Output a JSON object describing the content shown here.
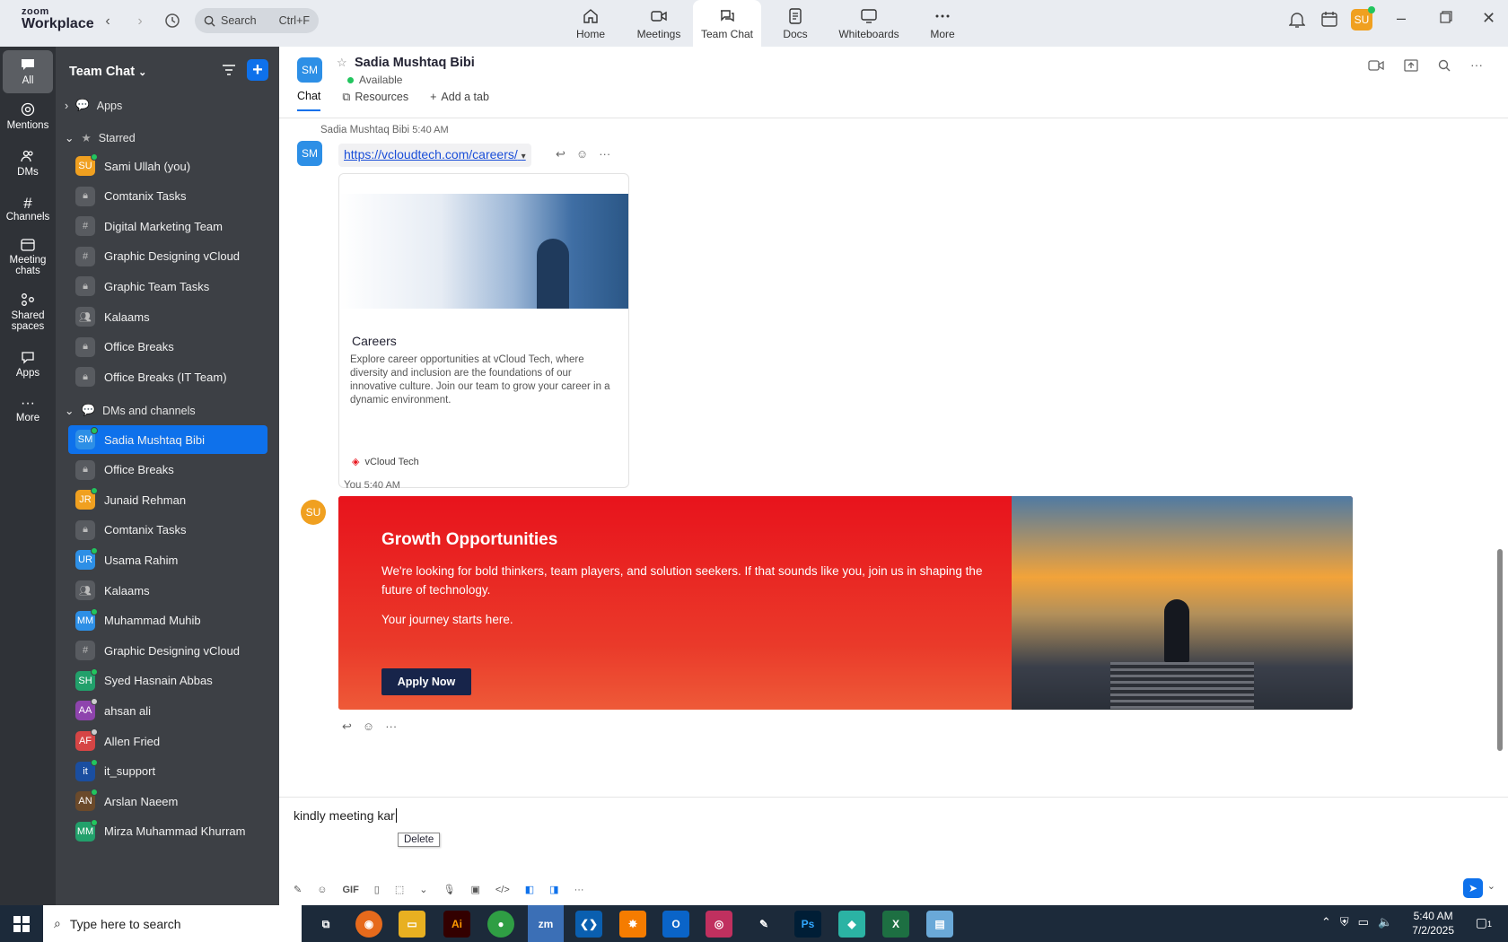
{
  "app": {
    "brand_top": "zoom",
    "brand_bottom": "Workplace"
  },
  "search": {
    "label": "Search",
    "shortcut": "Ctrl+F"
  },
  "topnav": [
    {
      "label": "Home",
      "icon": "home-icon"
    },
    {
      "label": "Meetings",
      "icon": "video-icon"
    },
    {
      "label": "Team Chat",
      "icon": "chat-icon"
    },
    {
      "label": "Docs",
      "icon": "docs-icon"
    },
    {
      "label": "Whiteboards",
      "icon": "whiteboard-icon"
    },
    {
      "label": "More",
      "icon": "more-icon"
    }
  ],
  "user": {
    "initials": "SU",
    "color": "#f0a020"
  },
  "rail": [
    {
      "label": "All"
    },
    {
      "label": "Mentions"
    },
    {
      "label": "DMs"
    },
    {
      "label": "Channels"
    },
    {
      "label": "Meeting chats"
    },
    {
      "label": "Shared spaces"
    },
    {
      "label": "Apps"
    },
    {
      "label": "More"
    }
  ],
  "sidebar": {
    "title": "Team Chat",
    "apps": "Apps",
    "starred": "Starred",
    "dms_section": "DMs and channels",
    "starred_items": [
      {
        "label": "Sami Ullah (you)",
        "ic": "SU",
        "color": "#f0a020",
        "status": "#22c55e"
      },
      {
        "label": "Comtanix Tasks",
        "ic": "lock"
      },
      {
        "label": "Digital Marketing Team",
        "ic": "#"
      },
      {
        "label": "Graphic Designing vCloud",
        "ic": "#"
      },
      {
        "label": "Graphic Team Tasks",
        "ic": "lock"
      },
      {
        "label": "Kalaams",
        "ic": "group"
      },
      {
        "label": "Office Breaks",
        "ic": "lock"
      },
      {
        "label": "Office Breaks (IT Team)",
        "ic": "lock"
      }
    ],
    "dm_items": [
      {
        "label": "Sadia Mushtaq Bibi",
        "ic": "SM",
        "color": "#2d8fe6",
        "status": "#22c55e",
        "selected": true
      },
      {
        "label": "Office Breaks",
        "ic": "lock"
      },
      {
        "label": "Junaid Rehman",
        "ic": "JR",
        "color": "#f0a020",
        "status": "#22c55e"
      },
      {
        "label": "Comtanix Tasks",
        "ic": "lock"
      },
      {
        "label": "Usama Rahim",
        "ic": "UR",
        "color": "#2d8fe6",
        "status": "#22c55e"
      },
      {
        "label": "Kalaams",
        "ic": "group"
      },
      {
        "label": "Muhammad Muhib",
        "ic": "MM",
        "color": "#2d8fe6",
        "status": "#22c55e"
      },
      {
        "label": "Graphic Designing vCloud",
        "ic": "#"
      },
      {
        "label": "Syed Hasnain Abbas",
        "ic": "SH",
        "color": "#22a06b",
        "status": "#22c55e"
      },
      {
        "label": "ahsan ali",
        "ic": "AA",
        "color": "#8e44ad",
        "status": "#cccccc"
      },
      {
        "label": "Allen Fried",
        "ic": "AF",
        "color": "#d64545",
        "status": "#cccccc"
      },
      {
        "label": "it_support",
        "ic": "it",
        "color": "#1a4ea0",
        "status": "#22c55e"
      },
      {
        "label": "Arslan Naeem",
        "ic": "AN",
        "color": "#6b4a2b",
        "status": "#22c55e"
      },
      {
        "label": "Mirza Muhammad Khurram",
        "ic": "MM",
        "color": "#22a06b",
        "status": "#22c55e"
      }
    ]
  },
  "chat": {
    "avatar": "SM",
    "name": "Sadia Mushtaq Bibi",
    "status": "Available",
    "tabs": [
      "Chat",
      "Resources",
      "Add a tab"
    ],
    "msg1": {
      "sender": "Sadia Mushtaq Bibi",
      "time": "5:40 AM",
      "link": "https://vcloudtech.com/careers/",
      "card": {
        "title": "Careers",
        "desc": "Explore career opportunities at vCloud Tech, where diversity and inclusion are the foundations of our innovative culture. Join our team to grow your career in a dynamic environment.",
        "site": "vCloud Tech"
      }
    },
    "msg2": {
      "sender": "You",
      "time": "5:40 AM",
      "avatar": "SU",
      "banner": {
        "title": "Growth Opportunities",
        "body": "We're looking for bold thinkers, team players, and solution seekers. If that sounds like you, join us in shaping the future of technology.",
        "tagline": "Your journey starts here.",
        "button": "Apply Now"
      }
    },
    "composer": {
      "text": "kindly meeting kar ",
      "tooltip": "Delete",
      "gif": "GIF"
    }
  },
  "taskbar": {
    "search_placeholder": "Type here to search",
    "time": "5:40 AM",
    "date": "7/2/2025",
    "notif": "1"
  }
}
